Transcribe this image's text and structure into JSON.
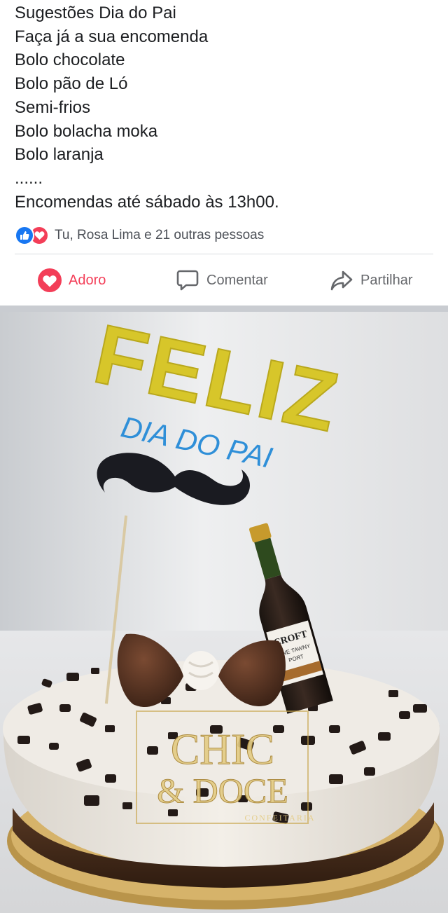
{
  "post": {
    "lines": [
      "Sugestões Dia do Pai",
      "Faça já a sua encomenda",
      "Bolo chocolate",
      "Bolo pão de Ló",
      "Semi-frios",
      "Bolo bolacha moka",
      "Bolo laranja",
      "......",
      "Encomendas até sábado às 13h00."
    ]
  },
  "reactions": {
    "icons": [
      "like-icon",
      "love-icon"
    ],
    "summary": "Tu, Rosa Lima e 21 outras pessoas"
  },
  "actions": {
    "love_label": "Adoro",
    "comment_label": "Comentar",
    "share_label": "Partilhar"
  },
  "photo": {
    "topper_line1": "FELIZ",
    "topper_line2": "DIA DO PAI",
    "bottle_brand": "CROFT",
    "bottle_line": "FINE TAWNY",
    "bottle_type": "PORT",
    "watermark_line1": "CHIC",
    "watermark_line2": "& DOCE",
    "watermark_line3": "CONFEITARIA"
  },
  "colors": {
    "text": "#1c1e21",
    "muted": "#65676b",
    "love": "#f33e58",
    "like": "#1877f2",
    "separator": "#c9ccd1",
    "topper_yellow": "#d7c62a",
    "topper_blue": "#2f8fd8"
  }
}
